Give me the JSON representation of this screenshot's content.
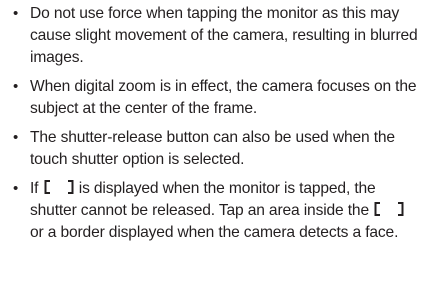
{
  "bullets": [
    {
      "text": "Do not use force when tapping the monitor as this may cause slight movement of the camera, resulting in blurred images."
    },
    {
      "text": "When digital zoom is in effect, the camera focuses on the subject at the center of the frame."
    },
    {
      "text": "The shutter-release button can also be used when the touch shutter option is selected."
    },
    {
      "part1": "If",
      "part2": "is displayed when the monitor is tapped, the shutter cannot be released. Tap an area inside the",
      "part3": "or a border displayed when the camera detects a face."
    }
  ],
  "bullet_symbol": "•",
  "icons": {
    "focus_bracket": "focus-bracket-icon"
  }
}
